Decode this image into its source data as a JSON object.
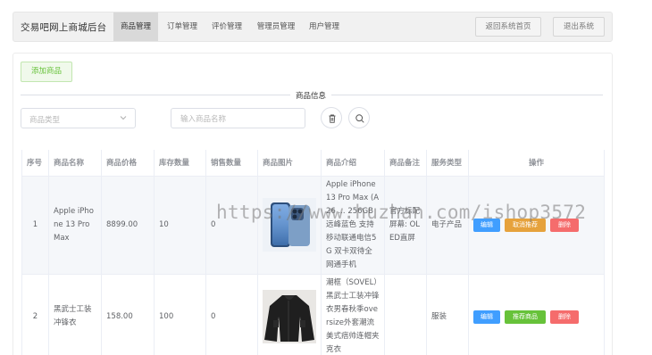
{
  "header": {
    "brand": "交易吧网上商城后台",
    "tabs": [
      {
        "label": "商品管理",
        "active": true
      },
      {
        "label": "订单管理",
        "active": false
      },
      {
        "label": "评价管理",
        "active": false
      },
      {
        "label": "管理员管理",
        "active": false
      },
      {
        "label": "用户管理",
        "active": false
      }
    ],
    "home_button": "返回系统首页",
    "logout_button": "退出系统"
  },
  "toolbar": {
    "add_button": "添加商品",
    "section_title": "商品信息",
    "type_select_placeholder": "商品类型",
    "name_search_placeholder": "输入商品名称",
    "delete_icon": "trash-icon",
    "search_icon": "search-icon"
  },
  "table": {
    "columns": [
      "序号",
      "商品名称",
      "商品价格",
      "库存数量",
      "销售数量",
      "商品图片",
      "商品介绍",
      "商品备注",
      "服务类型",
      "操作"
    ],
    "rows": [
      {
        "index": "1",
        "name": "Apple iPhone 13 Pro Max",
        "price": "8899.00",
        "stock": "10",
        "sales": "0",
        "image": "blue-iphone-image",
        "intro": "Apple iPhone 13 Pro Max (A26 ... 256GB 远峰蓝色 支持移动联通电信5G 双卡双待全网通手机",
        "remark": "官方标配 屏幕: OLED直屏",
        "service": "电子产品",
        "actions": [
          "编辑",
          "取消推荐",
          "删除"
        ]
      },
      {
        "index": "2",
        "name": "黑武士工装冲锋衣",
        "price": "158.00",
        "stock": "100",
        "sales": "0",
        "image": "black-jacket-image",
        "intro": "潮框（SOVEL）黑武士工装冲锋衣男春秋季oversize外套潮流美式痞帅连帽夹克衣",
        "remark": "",
        "service": "服装",
        "actions": [
          "编辑",
          "推荐商品",
          "删除"
        ]
      }
    ]
  },
  "watermark": "https://www.huzhan.com/ishop3572",
  "colors": {
    "primary": "#409eff",
    "success": "#67c23a",
    "warning": "#e6a23c",
    "danger": "#f56c6c"
  }
}
